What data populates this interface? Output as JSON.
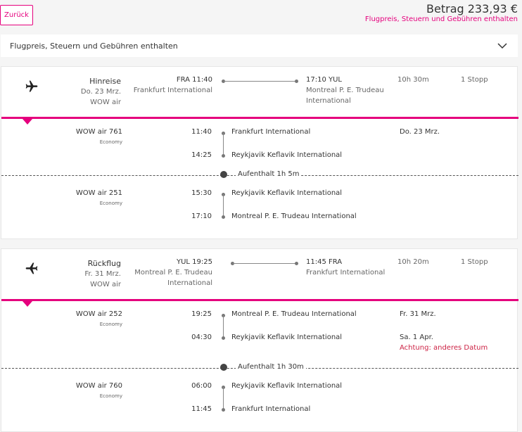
{
  "header": {
    "back_label": "Zurück",
    "price_label": "Betrag 233,93 €",
    "price_sub": "Flugpreis, Steuern und Gebühren enthalten"
  },
  "summary": {
    "label": "Flugpreis, Steuern und Gebühren enthalten"
  },
  "outbound": {
    "title": "Hinreise",
    "date": "Do. 23 Mrz.",
    "airline": "WOW air",
    "dep": "FRA 11:40",
    "dep_airport": "Frankfurt International",
    "arr": "17:10 YUL",
    "arr_airport_1": "Montreal P. E. Trudeau",
    "arr_airport_2": "International",
    "duration": "10h 30m",
    "stops": "1 Stopp",
    "seg1": {
      "flight": "WOW air 761",
      "class": "Economy",
      "dep_time": "11:40",
      "dep_airport": "Frankfurt International",
      "dep_date": "Do. 23 Mrz.",
      "arr_time": "14:25",
      "arr_airport": "Reykjavik Keflavik International"
    },
    "layover": "Aufenthalt 1h 5m",
    "seg2": {
      "flight": "WOW air 251",
      "class": "Economy",
      "dep_time": "15:30",
      "dep_airport": "Reykjavik Keflavik International",
      "arr_time": "17:10",
      "arr_airport": "Montreal P. E. Trudeau International"
    }
  },
  "return": {
    "title": "Rückflug",
    "date": "Fr. 31 Mrz.",
    "airline": "WOW air",
    "dep": "YUL 19:25",
    "dep_airport_1": "Montreal P. E. Trudeau",
    "dep_airport_2": "International",
    "arr": "11:45 FRA",
    "arr_airport": "Frankfurt International",
    "duration": "10h 20m",
    "stops": "1 Stopp",
    "seg1": {
      "flight": "WOW air 252",
      "class": "Economy",
      "dep_time": "19:25",
      "dep_airport": "Montreal P. E. Trudeau International",
      "dep_date": "Fr. 31 Mrz.",
      "arr_time": "04:30",
      "arr_airport": "Reykjavik Keflavik International",
      "arr_date": "Sa. 1 Apr.",
      "warning": "Achtung: anderes Datum"
    },
    "layover": "Aufenthalt 1h 30m",
    "seg2": {
      "flight": "WOW air 760",
      "class": "Economy",
      "dep_time": "06:00",
      "dep_airport": "Reykjavik Keflavik International",
      "arr_time": "11:45",
      "arr_airport": "Frankfurt International"
    }
  },
  "icons": {
    "plane": "airplane-icon",
    "chevron": "chevron-down-icon",
    "clock": "clock-icon"
  },
  "colors": {
    "accent": "#e5007d",
    "warning": "#cc2244"
  }
}
